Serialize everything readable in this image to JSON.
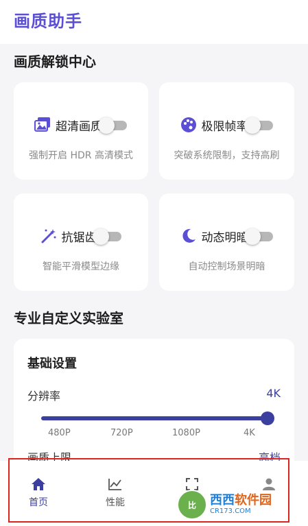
{
  "app": {
    "title": "画质助手"
  },
  "unlock_section": {
    "title": "画质解锁中心",
    "cards": [
      {
        "label": "超清画质",
        "desc": "强制开启 HDR 高清模式",
        "icon": "image-stack-icon",
        "enabled": false
      },
      {
        "label": "极限帧率",
        "desc": "突破系统限制，支持高刷",
        "icon": "palette-icon",
        "enabled": false
      },
      {
        "label": "抗锯齿",
        "desc": "智能平滑模型边缘",
        "icon": "magic-wand-icon",
        "enabled": false
      },
      {
        "label": "动态明暗",
        "desc": "自动控制场景明暗",
        "icon": "moon-icon",
        "enabled": false
      }
    ]
  },
  "lab_section": {
    "title": "专业自定义实验室",
    "basic": {
      "title": "基础设置",
      "resolution_label": "分辨率",
      "resolution_value": "4K",
      "ticks": [
        "480P",
        "720P",
        "1080P",
        "4K"
      ],
      "slider_fraction": 1.0,
      "quality_label": "画质上限",
      "quality_value": "高档"
    }
  },
  "nav": {
    "items": [
      {
        "label": "首页",
        "icon": "home-icon",
        "active": true
      },
      {
        "label": "性能",
        "icon": "chart-icon",
        "active": false
      },
      {
        "label": "",
        "icon": "fullscreen-icon",
        "active": false
      },
      {
        "label": "",
        "icon": "user-icon",
        "active": false
      }
    ]
  },
  "watermark": {
    "badge": "比",
    "main_a": "西西",
    "main_b": "软件园",
    "url": "CR173.COM"
  },
  "colors": {
    "accent": "#5b4fd3",
    "primary": "#3b3fa0",
    "highlight": "#d9261c"
  }
}
